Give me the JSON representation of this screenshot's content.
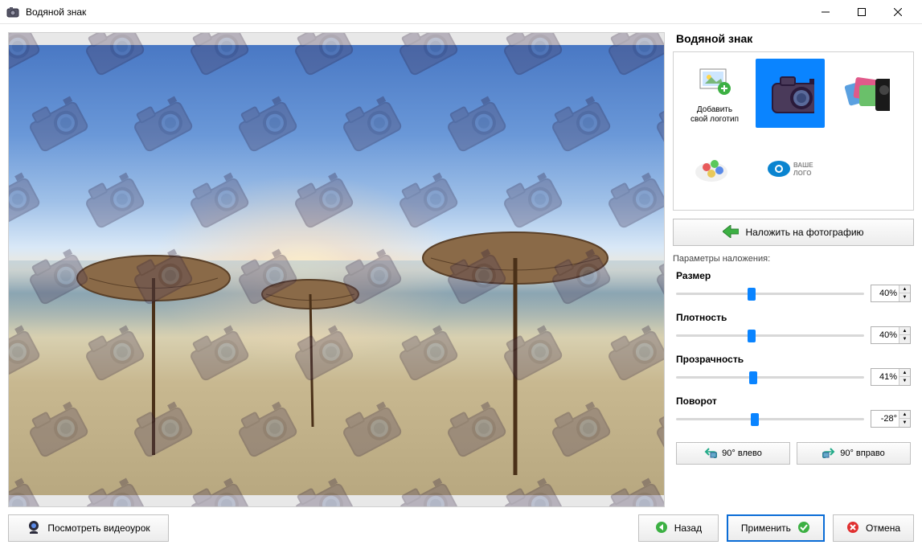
{
  "window": {
    "title": "Водяной знак"
  },
  "side": {
    "heading": "Водяной знак",
    "add_logo_line1": "Добавить",
    "add_logo_line2": "свой логотип",
    "overlay_button": "Наложить на фотографию",
    "params_label": "Параметры наложения:"
  },
  "params": {
    "size": {
      "label": "Размер",
      "value": "40%",
      "percent": 40
    },
    "density": {
      "label": "Плотность",
      "value": "40%",
      "percent": 40
    },
    "opacity": {
      "label": "Прозрачность",
      "value": "41%",
      "percent": 41
    },
    "rotation": {
      "label": "Поворот",
      "value": "-28°",
      "percent": 42
    }
  },
  "rotate": {
    "left": "90° влево",
    "right": "90° вправо"
  },
  "footer": {
    "video": "Посмотреть видеоурок",
    "back": "Назад",
    "apply": "Применить",
    "cancel": "Отмена"
  }
}
